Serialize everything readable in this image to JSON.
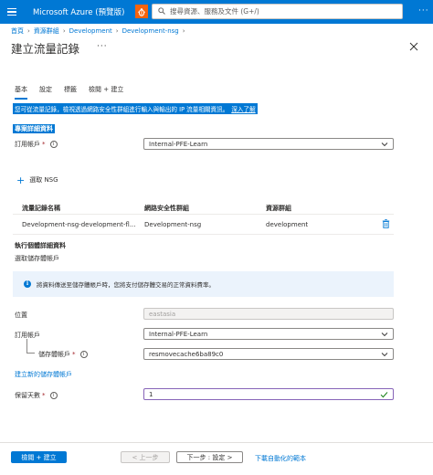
{
  "header": {
    "brand": "Microsoft Azure (預覽版)",
    "search_placeholder": "搜尋資源、服務及文件 (G+/)",
    "more": "···"
  },
  "breadcrumb": [
    "首頁",
    "資源群組",
    "Development",
    "Development-nsg"
  ],
  "page": {
    "title": "建立流量記錄",
    "more": "···"
  },
  "tabs": [
    "基本",
    "設定",
    "標籤",
    "檢閱 + 建立"
  ],
  "description": "您可從流量記錄，檢視透過網路安全性群組進行輸入與輸出的 IP 流量相關資訊。",
  "description_link": "深入了解",
  "project_details": {
    "heading": "專案詳細資料",
    "subscription_label": "訂用帳戶",
    "subscription_value": "Internal-PFE-Learn"
  },
  "nsg": {
    "add_label": "選取 NSG",
    "columns": [
      "流量記錄名稱",
      "網路安全性群組",
      "資源群組"
    ],
    "rows": [
      [
        "Development-nsg-development-fl...",
        "Development-nsg",
        "development"
      ]
    ]
  },
  "instance_details": {
    "heading": "執行個體詳細資料",
    "select_storage": "選取儲存體帳戶",
    "info_text": "將資料傳送至儲存體帳戶時，您將支付儲存體交易的正常資料費率。",
    "location_label": "位置",
    "location_value": "eastasia",
    "subscription_label": "訂用帳戶",
    "subscription_value": "Internal-PFE-Learn",
    "storage_label": "儲存體帳戶",
    "storage_value": "resmovecache6ba89c0",
    "create_storage_link": "建立新的儲存體帳戶",
    "retention_label": "保留天數",
    "retention_value": "1"
  },
  "footer": {
    "review_create": "檢閱 + 建立",
    "previous": "< 上一步",
    "next": "下一步 : 設定 >",
    "download_template": "下載自動化的範本"
  },
  "colors": {
    "accent": "#0078d4",
    "required": "#a4262c",
    "bug_orange": "#f7630c",
    "focus_purple": "#8764b8"
  }
}
